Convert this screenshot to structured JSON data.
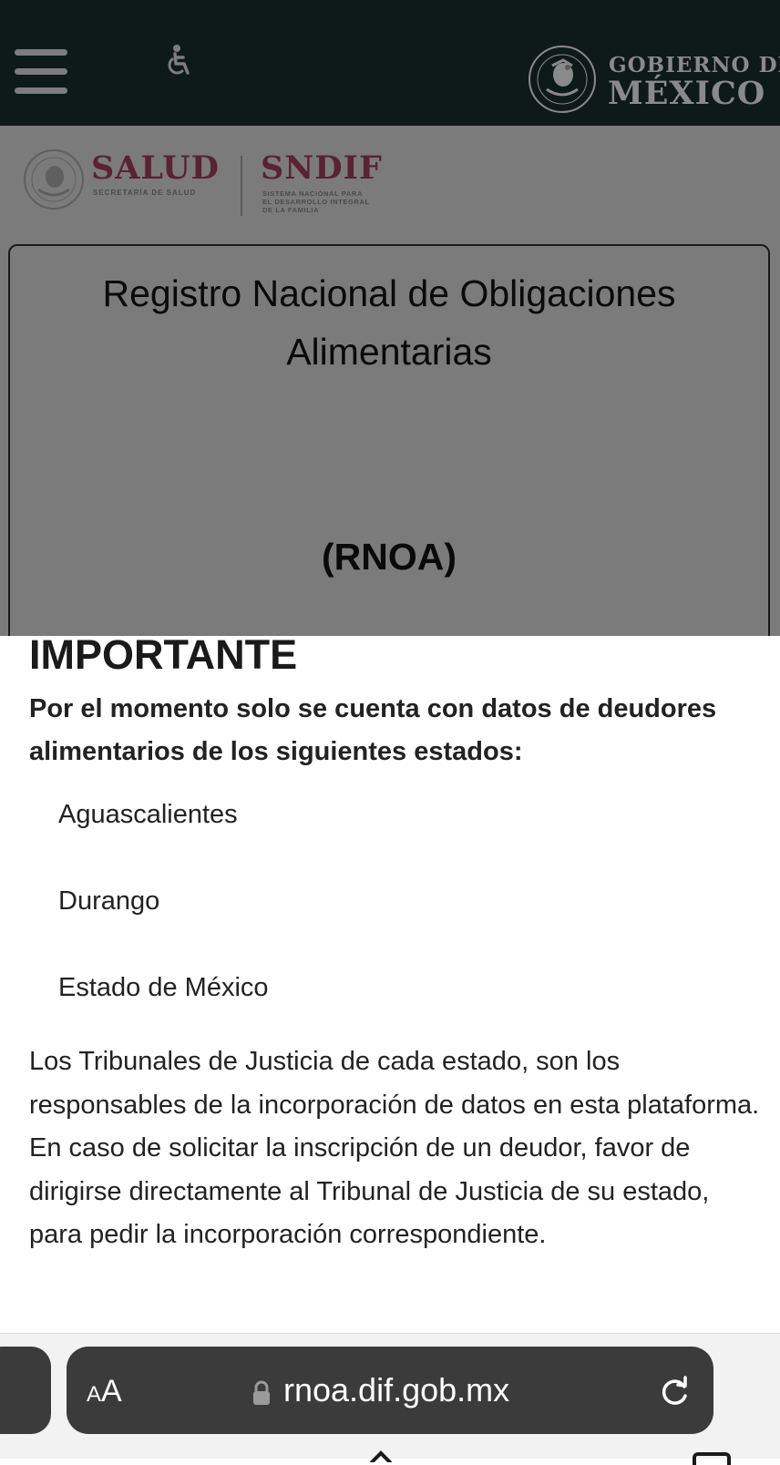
{
  "navbar": {
    "gob_line1": "GOBIERNO DE",
    "gob_line2": "MÉXICO",
    "menu_icon": "hamburger-menu-icon",
    "accessibility_icon": "wheelchair-accessibility-icon",
    "seal_icon": "coat-of-arms-seal-icon"
  },
  "logos": {
    "salud_name": "SALUD",
    "salud_sub": "SECRETARÍA DE SALUD",
    "sndif_name": "SNDIF",
    "sndif_sub_lines": [
      "SISTEMA NACIONAL PARA",
      "EL DESARROLLO INTEGRAL",
      "DE LA FAMILIA"
    ]
  },
  "card": {
    "title_line1": "Registro Nacional de Obligaciones",
    "title_line2": "Alimentarias",
    "abbr": "(RNOA)"
  },
  "modal": {
    "heading": "IMPORTANTE",
    "subheading": "Por el momento solo se cuenta con datos de deudores alimentarios de los siguientes estados:",
    "states": [
      "Aguascalientes",
      "Durango",
      "Estado de México"
    ],
    "paragraph": "Los Tribunales de Justicia de cada estado, son los responsables de la incorporación de datos en esta plataforma. En caso de solicitar la inscripción de un deudor, favor de dirigirse directamente al Tribunal de Justicia de su estado, para pedir la incorporación correspondiente."
  },
  "browser": {
    "text_size_small": "A",
    "text_size_big": "A",
    "url": "rnoa.dif.gob.mx",
    "lock_icon": "lock-icon",
    "reload_icon": "reload-icon"
  },
  "colors": {
    "navbar_bg": "#0d1a18",
    "overlay_bg": "#7b7b7b",
    "brand_maroon": "#5a2233",
    "url_pill_bg": "#3b3b3b"
  }
}
